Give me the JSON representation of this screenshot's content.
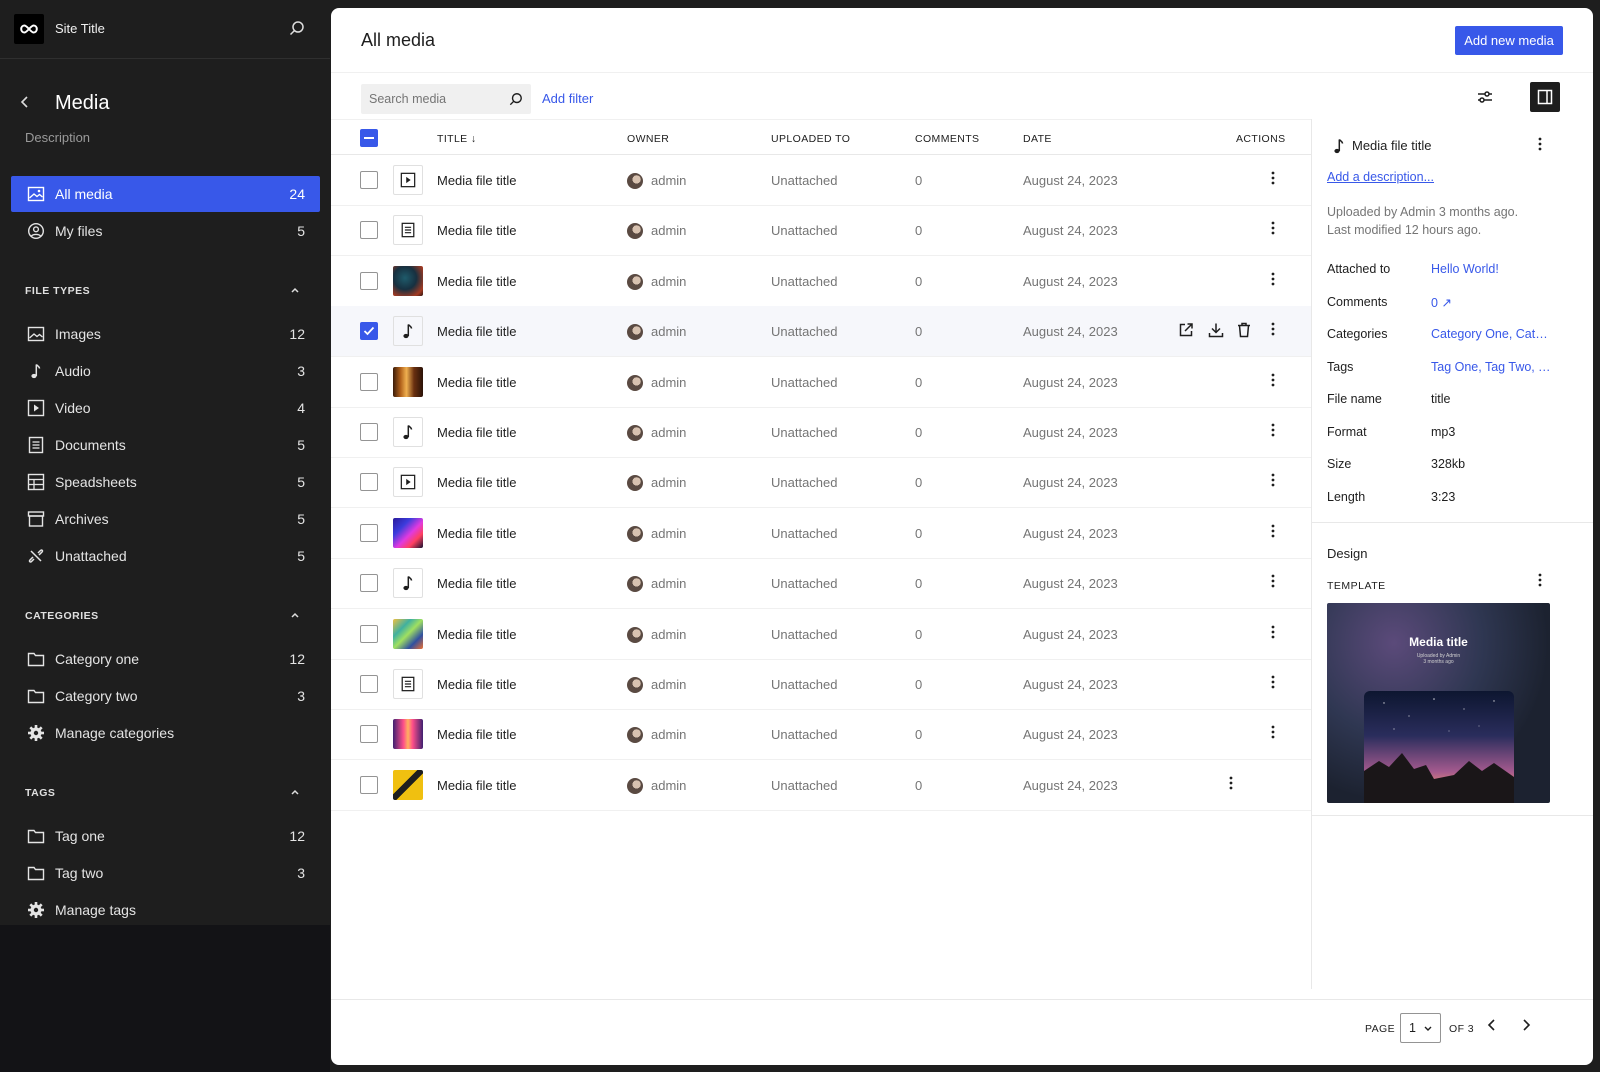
{
  "site": {
    "title": "Site Title"
  },
  "sidebar": {
    "title": "Media",
    "description": "Description",
    "main_items": [
      {
        "label": "All media",
        "count": "24",
        "icon": "image-icon",
        "active": true
      },
      {
        "label": "My files",
        "count": "5",
        "icon": "user-circle-icon",
        "active": false
      }
    ],
    "file_types": {
      "heading": "FILE TYPES",
      "items": [
        {
          "label": "Images",
          "count": "12",
          "icon": "image-icon"
        },
        {
          "label": "Audio",
          "count": "3",
          "icon": "audio-icon"
        },
        {
          "label": "Video",
          "count": "4",
          "icon": "video-icon"
        },
        {
          "label": "Documents",
          "count": "5",
          "icon": "document-icon"
        },
        {
          "label": "Speadsheets",
          "count": "5",
          "icon": "table-icon"
        },
        {
          "label": "Archives",
          "count": "5",
          "icon": "archive-icon"
        },
        {
          "label": "Unattached",
          "count": "5",
          "icon": "unlink-icon"
        }
      ]
    },
    "categories": {
      "heading": "CATEGORIES",
      "items": [
        {
          "label": "Category one",
          "count": "12",
          "icon": "folder-icon"
        },
        {
          "label": "Category two",
          "count": "3",
          "icon": "folder-icon"
        },
        {
          "label": "Manage categories",
          "count": "",
          "icon": "gear-icon"
        }
      ]
    },
    "tags": {
      "heading": "TAGS",
      "items": [
        {
          "label": "Tag one",
          "count": "12",
          "icon": "folder-icon"
        },
        {
          "label": "Tag two",
          "count": "3",
          "icon": "folder-icon"
        },
        {
          "label": "Manage tags",
          "count": "",
          "icon": "gear-icon"
        }
      ]
    }
  },
  "header": {
    "title": "All media",
    "add_new_label": "Add new media"
  },
  "toolbar": {
    "search_placeholder": "Search media",
    "add_filter_label": "Add filter"
  },
  "table": {
    "columns": {
      "title": "TITLE",
      "owner": "OWNER",
      "uploaded_to": "UPLOADED TO",
      "comments": "COMMENTS",
      "date": "DATE",
      "actions": "ACTIONS"
    },
    "rows": [
      {
        "thumb": "video",
        "title": "Media file title",
        "owner": "admin",
        "uploaded_to": "Unattached",
        "comments": "0",
        "date": "August 24, 2023",
        "selected": false
      },
      {
        "thumb": "document",
        "title": "Media file title",
        "owner": "admin",
        "uploaded_to": "Unattached",
        "comments": "0",
        "date": "August 24, 2023",
        "selected": false
      },
      {
        "thumb": "image-dark",
        "title": "Media file title",
        "owner": "admin",
        "uploaded_to": "Unattached",
        "comments": "0",
        "date": "August 24, 2023",
        "selected": false
      },
      {
        "thumb": "audio",
        "title": "Media file title",
        "owner": "admin",
        "uploaded_to": "Unattached",
        "comments": "0",
        "date": "August 24, 2023",
        "selected": true
      },
      {
        "thumb": "image-forest",
        "title": "Media file title",
        "owner": "admin",
        "uploaded_to": "Unattached",
        "comments": "0",
        "date": "August 24, 2023",
        "selected": false
      },
      {
        "thumb": "audio",
        "title": "Media file title",
        "owner": "admin",
        "uploaded_to": "Unattached",
        "comments": "0",
        "date": "August 24, 2023",
        "selected": false
      },
      {
        "thumb": "video",
        "title": "Media file title",
        "owner": "admin",
        "uploaded_to": "Unattached",
        "comments": "0",
        "date": "August 24, 2023",
        "selected": false
      },
      {
        "thumb": "image-purple",
        "title": "Media file title",
        "owner": "admin",
        "uploaded_to": "Unattached",
        "comments": "0",
        "date": "August 24, 2023",
        "selected": false
      },
      {
        "thumb": "audio",
        "title": "Media file title",
        "owner": "admin",
        "uploaded_to": "Unattached",
        "comments": "0",
        "date": "August 24, 2023",
        "selected": false
      },
      {
        "thumb": "image-swirl",
        "title": "Media file title",
        "owner": "admin",
        "uploaded_to": "Unattached",
        "comments": "0",
        "date": "August 24, 2023",
        "selected": false
      },
      {
        "thumb": "document",
        "title": "Media file title",
        "owner": "admin",
        "uploaded_to": "Unattached",
        "comments": "0",
        "date": "August 24, 2023",
        "selected": false
      },
      {
        "thumb": "image-pink",
        "title": "Media file title",
        "owner": "admin",
        "uploaded_to": "Unattached",
        "comments": "0",
        "date": "August 24, 2023",
        "selected": false
      },
      {
        "thumb": "image-yellow",
        "title": "Media file title",
        "owner": "admin",
        "uploaded_to": "Unattached",
        "comments": "0",
        "date": "August 24, 2023",
        "selected": false
      }
    ]
  },
  "inspector": {
    "title": "Media file title",
    "add_description": "Add a description...",
    "uploaded_by": "Uploaded by Admin 3 months ago.",
    "last_modified": "Last modified 12 hours ago.",
    "fields": [
      {
        "label": "Attached to",
        "value": "Hello World!",
        "link": true
      },
      {
        "label": "Comments",
        "value": "0 ↗",
        "link": true
      },
      {
        "label": "Categories",
        "value": "Category One, Category Two",
        "link": true
      },
      {
        "label": "Tags",
        "value": "Tag One, Tag Two, Tag Three",
        "link": true
      },
      {
        "label": "File name",
        "value": "title",
        "link": false
      },
      {
        "label": "Format",
        "value": "mp3",
        "link": false
      },
      {
        "label": "Size",
        "value": "328kb",
        "link": false
      },
      {
        "label": "Length",
        "value": "3:23",
        "link": false
      }
    ],
    "design_heading": "Design",
    "template_heading": "TEMPLATE",
    "preview": {
      "title": "Media title",
      "subtitle_1": "Uploaded by Admin",
      "subtitle_2": "3 months ago"
    }
  },
  "pagination": {
    "page_label": "PAGE",
    "current": "1",
    "of_label": "OF 3"
  },
  "colors": {
    "accent": "#3858e9",
    "sidebar_bg": "#1e1e1e"
  }
}
